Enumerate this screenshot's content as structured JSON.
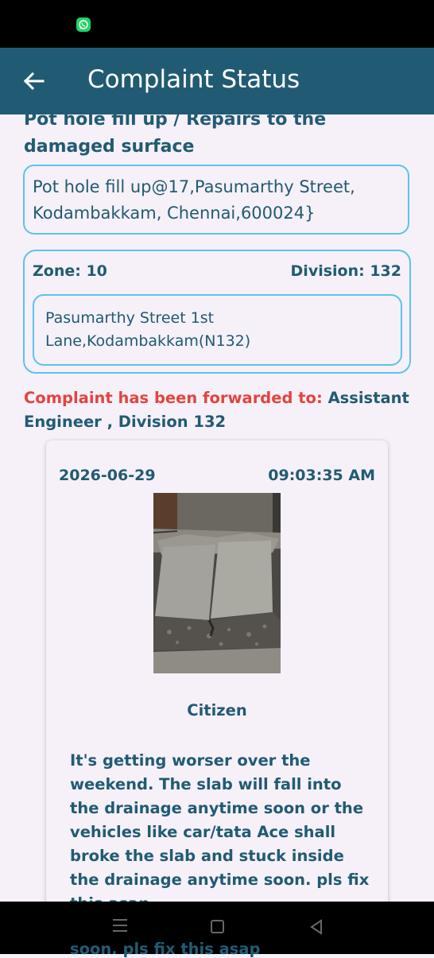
{
  "status_bar": {
    "notification_icon": "whatsapp-icon",
    "notification_color": "#25d366"
  },
  "appbar": {
    "title": "Complaint Status",
    "back_icon": "arrow-left-icon",
    "color": "#215b73"
  },
  "complaint": {
    "subject": "Pot hole fill up / Repairs to the damaged surface",
    "description": "Pot hole fill up@17,Pasumarthy Street, Kodambakkam, Chennai,600024}",
    "zone_label": "Zone: 10",
    "division_label": "Division: 132",
    "street": "Pasumarthy Street 1st Lane,Kodambakkam(N132)",
    "forwarded_label": "Complaint has been forwarded to:",
    "forwarded_to": "Assistant Engineer , Division 132",
    "forwarded_label_color": "#e04540"
  },
  "update_card": {
    "date": "2026-06-29",
    "time": "09:03:35 AM",
    "photo_description_icon": "photo-broken-slab",
    "author": "Citizen",
    "comment": "It's getting worser over the weekend. The slab will fall into the drainage anytime soon or the vehicles like car/tata Ace shall broke the slab and stuck inside the drainage anytime soon. pls fix this asap"
  },
  "nav_bar": {
    "menu_icon": "menu-icon",
    "home_icon": "home-square-icon",
    "back_icon": "back-triangle-icon"
  },
  "overflow_fragment": "soon. pls fix this asap"
}
